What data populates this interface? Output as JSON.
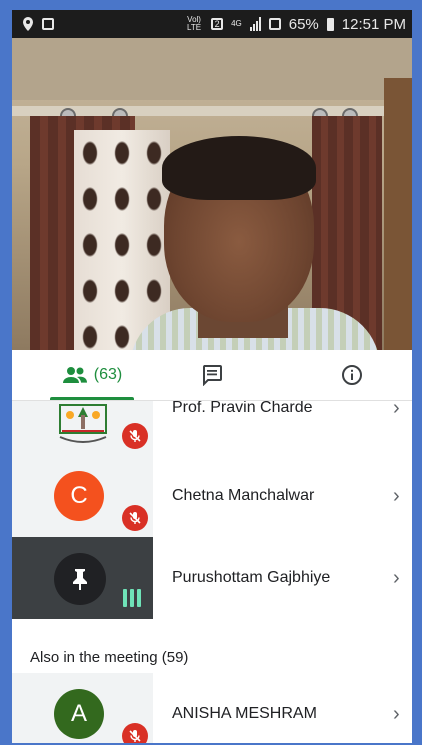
{
  "status_bar": {
    "volte_label": "Vol) LTE",
    "sim_label": "2",
    "network_label": "4G",
    "battery_percent": "65%",
    "time": "12:51 PM"
  },
  "tabs": {
    "people_count": "(63)",
    "active_color": "#1e8e3e",
    "icons": [
      "people-icon",
      "chat-icon",
      "info-icon"
    ]
  },
  "participants": [
    {
      "name": "Prof. Pravin Charde",
      "avatar_type": "logo",
      "muted": true
    },
    {
      "name": "Chetna Manchalwar",
      "avatar_letter": "C",
      "avatar_color": "#f4511e",
      "muted": true
    },
    {
      "name": "Purushottam Gajbhiye",
      "avatar_type": "pinned",
      "speaking": true
    }
  ],
  "also_in_meeting": {
    "title": "Also in the meeting (59)",
    "participants": [
      {
        "name": "ANISHA MESHRAM",
        "avatar_letter": "A",
        "avatar_color": "#33691e",
        "muted": true
      }
    ]
  }
}
